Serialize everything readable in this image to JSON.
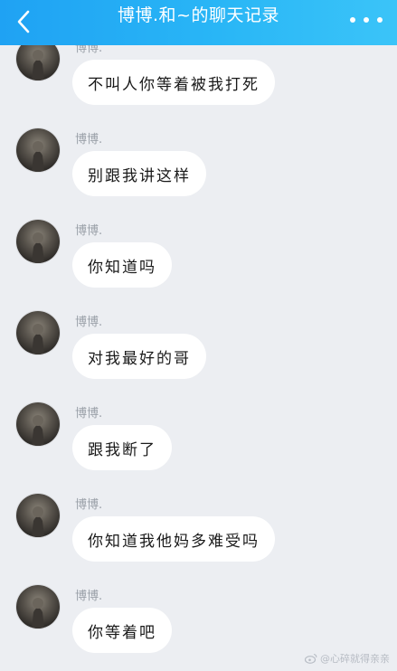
{
  "header": {
    "title": "博博.和~的聊天记录",
    "back_icon": "chevron-left-icon",
    "more_icon": "more-dots-icon",
    "color": "#29b6f6"
  },
  "messages": [
    {
      "sender": "博博.",
      "text": "不叫人你等着被我打死"
    },
    {
      "sender": "博博.",
      "text": "别跟我讲这样"
    },
    {
      "sender": "博博.",
      "text": "你知道吗"
    },
    {
      "sender": "博博.",
      "text": "对我最好的哥"
    },
    {
      "sender": "博博.",
      "text": "跟我断了"
    },
    {
      "sender": "博博.",
      "text": "你知道我他妈多难受吗"
    },
    {
      "sender": "博博.",
      "text": "你等着吧"
    }
  ],
  "watermark": {
    "text": "@心碎就得亲亲"
  }
}
